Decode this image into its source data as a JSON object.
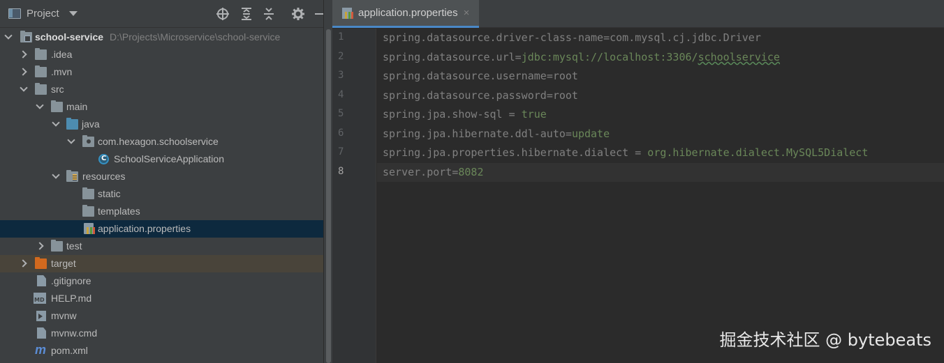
{
  "panel": {
    "title": "Project"
  },
  "tree": {
    "root": {
      "label": "school-service",
      "path": "D:\\Projects\\Microservice\\school-service"
    },
    "idea": ".idea",
    "mvn": ".mvn",
    "src": "src",
    "main": "main",
    "java": "java",
    "package": "com.hexagon.schoolservice",
    "app_class": "SchoolServiceApplication",
    "resources": "resources",
    "static": "static",
    "templates": "templates",
    "app_props": "application.properties",
    "test": "test",
    "target": "target",
    "gitignore": ".gitignore",
    "help": "HELP.md",
    "mvnw": "mvnw",
    "mvnw_cmd": "mvnw.cmd",
    "pom": "pom.xml"
  },
  "editor": {
    "tab_label": "application.properties",
    "tab_close": "×",
    "line_numbers": [
      "1",
      "2",
      "3",
      "4",
      "5",
      "6",
      "7",
      "8"
    ],
    "lines": [
      {
        "key": "spring.datasource.driver-class-name",
        "sep": "=",
        "value": "com.mysql.cj.jdbc.Driver"
      },
      {
        "key": "spring.datasource.url",
        "sep": "=",
        "value": "jdbc:mysql://localhost:3306/",
        "value2": "schoolservice"
      },
      {
        "key": "spring.datasource.username",
        "sep": "=",
        "value": "root"
      },
      {
        "key": "spring.datasource.password",
        "sep": "=",
        "value": "root"
      },
      {
        "key": "spring.jpa.show-sql",
        "sep": " = ",
        "value": "true"
      },
      {
        "key": "spring.jpa.hibernate.ddl-auto",
        "sep": "=",
        "value": "update"
      },
      {
        "key": "spring.jpa.properties.hibernate.dialect",
        "sep": " = ",
        "value": "org.hibernate.dialect.MySQL5Dialect"
      },
      {
        "key": "server.port",
        "sep": "=",
        "value": "8082"
      }
    ]
  },
  "watermark": "掘金技术社区 @ bytebeats"
}
